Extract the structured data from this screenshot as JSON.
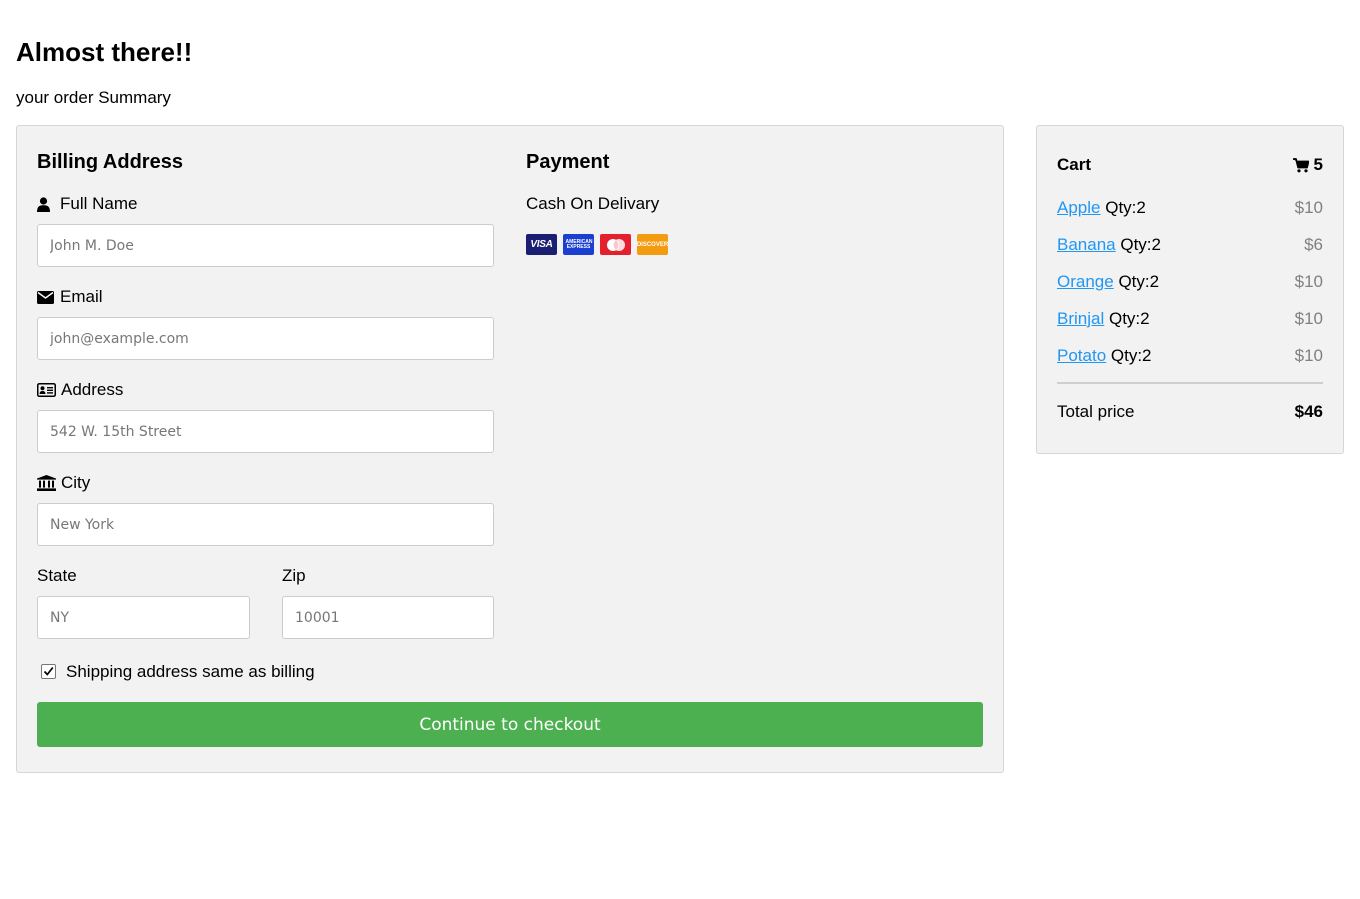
{
  "header": {
    "title": "Almost there!!",
    "subtitle": "your order Summary"
  },
  "billing": {
    "heading": "Billing Address",
    "full_name": {
      "label": "Full Name",
      "icon": "user-icon",
      "placeholder": "John M. Doe",
      "value": ""
    },
    "email": {
      "label": "Email",
      "icon": "envelope-icon",
      "placeholder": "john@example.com",
      "value": ""
    },
    "address": {
      "label": "Address",
      "icon": "address-card-icon",
      "placeholder": "542 W. 15th Street",
      "value": ""
    },
    "city": {
      "label": "City",
      "icon": "institution-icon",
      "placeholder": "New York",
      "value": ""
    },
    "state": {
      "label": "State",
      "placeholder": "NY",
      "value": ""
    },
    "zip": {
      "label": "Zip",
      "placeholder": "10001",
      "value": ""
    }
  },
  "payment": {
    "heading": "Payment",
    "method": "Cash On Delivary",
    "cards": [
      {
        "name": "visa",
        "text": "VISA",
        "icon": "visa-card-icon"
      },
      {
        "name": "amex",
        "text": "AMERICAN EXPRESS",
        "icon": "amex-card-icon"
      },
      {
        "name": "mastercard",
        "text": "",
        "icon": "mastercard-icon"
      },
      {
        "name": "discover",
        "text": "DISCOVER",
        "icon": "discover-card-icon"
      }
    ]
  },
  "shipping_same_as_billing": {
    "label": "Shipping address same as billing",
    "checked": true
  },
  "checkout_button": {
    "label": "Continue to checkout",
    "color": "#4caf50"
  },
  "cart": {
    "title": "Cart",
    "icon": "shopping-cart-icon",
    "count": "5",
    "items": [
      {
        "name": "Apple",
        "qty": "Qty:2",
        "price": "$10"
      },
      {
        "name": "Banana",
        "qty": "Qty:2",
        "price": "$6"
      },
      {
        "name": "Orange",
        "qty": "Qty:2",
        "price": "$10"
      },
      {
        "name": "Brinjal",
        "qty": "Qty:2",
        "price": "$10"
      },
      {
        "name": "Potato",
        "qty": "Qty:2",
        "price": "$10"
      }
    ],
    "total_label": "Total price",
    "total_value": "$46",
    "link_color": "#2196f3"
  }
}
